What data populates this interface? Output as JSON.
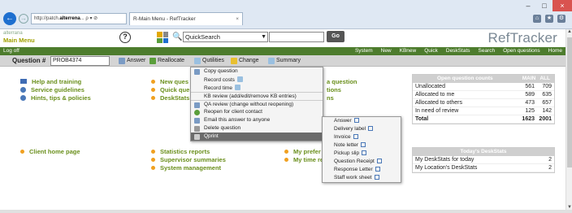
{
  "browser": {
    "address": "http://patch.alterrena...",
    "address_bold": "alterrena",
    "address_tail": " ρ ▾ ⊘",
    "tab_label": "R-Main Menu - RefTracker",
    "tab_close": "×",
    "win_min": "–",
    "win_max": "□",
    "win_close": "×"
  },
  "header": {
    "logo_text": "alterrana",
    "title": "Main Menu",
    "help_glyph": "?",
    "quick_search_value": "QuickSearch",
    "go_label": "Go",
    "brand": "RefTracker"
  },
  "navbar": {
    "logoff": "Log off",
    "items": [
      "System",
      "New",
      "KBnew",
      "Quick",
      "DeskStats",
      "Search",
      "Open questions",
      "Home"
    ]
  },
  "qbar": {
    "label": "Question #",
    "value": "PROB4374",
    "tools": [
      "Answer",
      "Reallocate",
      "Qutilities",
      "Change",
      "Summary"
    ]
  },
  "main": {
    "col1": [
      "Help and training",
      "Service guidelines",
      "Hints, tips & policies"
    ],
    "col2": [
      "New ques",
      "Quick que",
      "DeskStats"
    ],
    "col3": [
      "a question",
      "tions",
      "ns"
    ],
    "lower1": [
      "Client home page"
    ],
    "lower2": [
      "Statistics reports",
      "Supervisor summaries",
      "System management"
    ],
    "lower3": [
      "My prefer",
      "My time re"
    ]
  },
  "counts_panel": {
    "title": "Open question counts",
    "col_main": "MAIN",
    "col_all": "ALL",
    "rows": [
      {
        "label": "Unallocated",
        "main": "561",
        "all": "709"
      },
      {
        "label": "Allocated to me",
        "main": "589",
        "all": "635"
      },
      {
        "label": "Allocated to others",
        "main": "473",
        "all": "657"
      },
      {
        "label": "In need of review",
        "main": "125",
        "all": "142"
      },
      {
        "label": "Total",
        "main": "1623",
        "all": "2001"
      }
    ]
  },
  "deskstats_panel": {
    "title": "Today's DeskStats",
    "rows": [
      {
        "label": "My DeskStats for today",
        "value": "2"
      },
      {
        "label": "My Location's DeskStats",
        "value": "2"
      }
    ]
  },
  "qutilities_menu": {
    "items": [
      "Copy question",
      "Record costs",
      "Record time",
      "KB review (add/edit/remove KB entries)",
      "QA review (change without reopening)",
      "Reopen for client contact",
      "Email this answer to anyone",
      "Delete question",
      "Qprint"
    ]
  },
  "qprint_menu": {
    "items": [
      "Answer",
      "Delivery label",
      "Invoice",
      "Note letter",
      "Pickup slip",
      "Question Receipt",
      "Response Letter",
      "Staff work sheet"
    ]
  },
  "colors": {
    "nav_green": "#4d7c2d",
    "link_olive": "#6a8f1c",
    "brand_gray": "#7a8894",
    "menu_highlight": "#6b6b6b"
  }
}
